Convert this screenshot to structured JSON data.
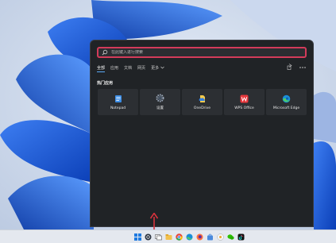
{
  "colors": {
    "panel_bg": "#202326",
    "search_border": "#d33b5a",
    "tile_bg": "#2c2f33",
    "taskbar_bg": "#e4e8ef",
    "arrow": "#d8323c"
  },
  "search": {
    "placeholder": "在此键入进行搜索"
  },
  "tabs": [
    {
      "label": "全部",
      "active": true
    },
    {
      "label": "应用",
      "active": false
    },
    {
      "label": "文档",
      "active": false
    },
    {
      "label": "网页",
      "active": false
    },
    {
      "label": "更多",
      "active": false
    }
  ],
  "header_icons": [
    "share-icon",
    "more-options-icon"
  ],
  "section": {
    "title": "热门应用"
  },
  "apps": [
    {
      "label": "Notepad",
      "icon": "notepad-icon"
    },
    {
      "label": "设置",
      "icon": "settings-gear-icon"
    },
    {
      "label": "OneDrive",
      "icon": "onedrive-icon"
    },
    {
      "label": "WPS Office",
      "icon": "wps-office-icon"
    },
    {
      "label": "Microsoft Edge",
      "icon": "edge-icon"
    }
  ],
  "taskbar": {
    "icons": [
      "windows-start-icon",
      "search-icon",
      "task-view-icon",
      "file-explorer-icon",
      "chrome-icon",
      "edge-icon",
      "firefox-icon",
      "store-icon",
      "browser-icon",
      "wechat-icon",
      "tiktok-icon"
    ]
  }
}
